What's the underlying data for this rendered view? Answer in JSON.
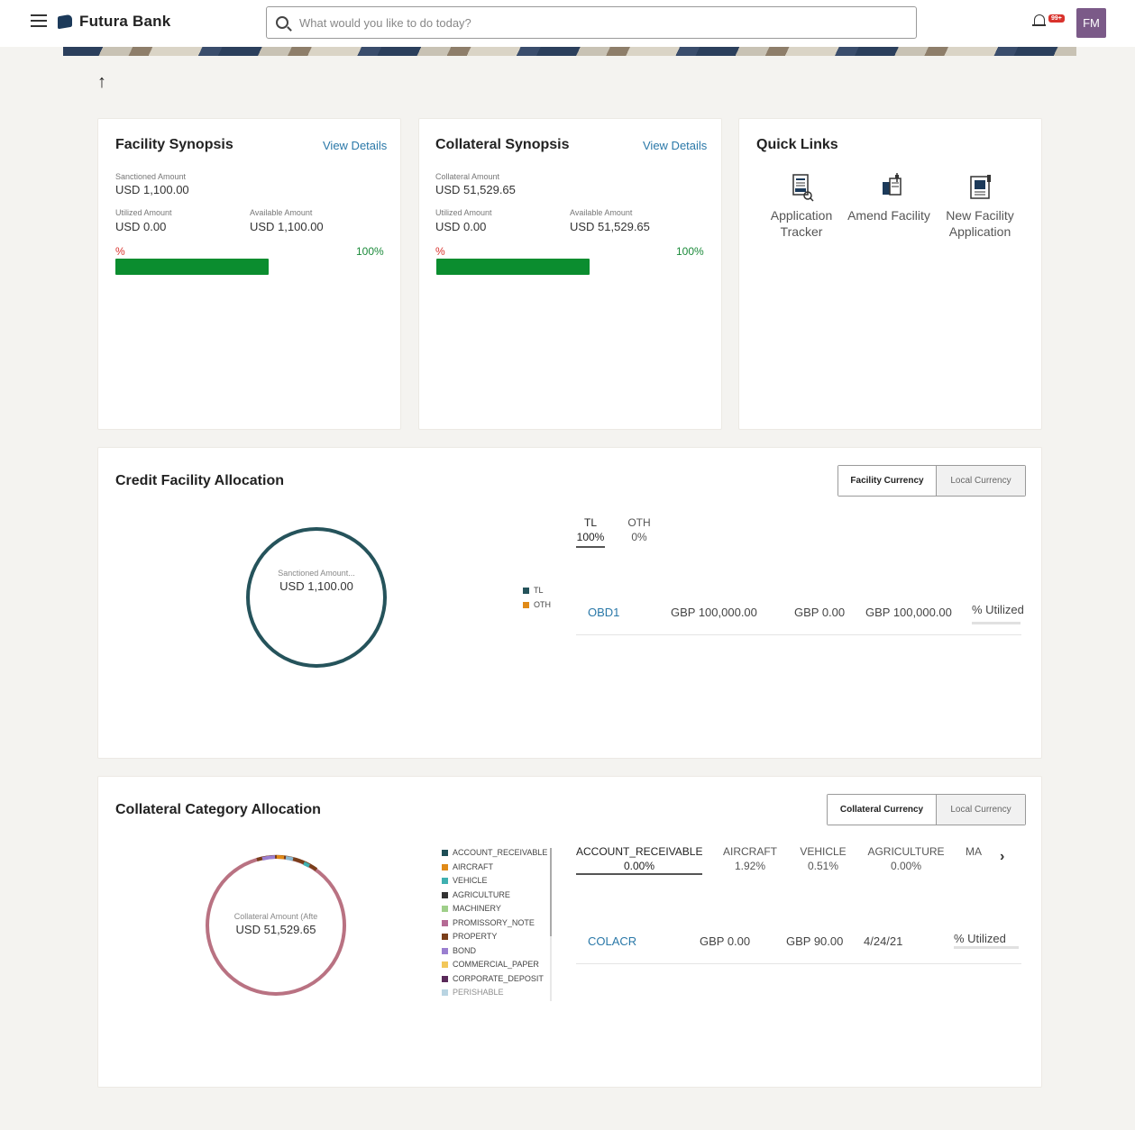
{
  "header": {
    "brand": "Futura Bank",
    "search_placeholder": "What would you like to do today?",
    "notification_badge": "99+",
    "avatar_initials": "FM"
  },
  "facility_synopsis": {
    "title": "Facility Synopsis",
    "view_details": "View Details",
    "sanctioned_label": "Sanctioned Amount",
    "sanctioned_value": "USD 1,100.00",
    "utilized_label": "Utilized Amount",
    "utilized_value": "USD 0.00",
    "available_label": "Available Amount",
    "available_value": "USD 1,100.00",
    "utilized_pct": "%",
    "available_pct": "100%"
  },
  "collateral_synopsis": {
    "title": "Collateral Synopsis",
    "view_details": "View Details",
    "collateral_label": "Collateral Amount",
    "collateral_value": "USD 51,529.65",
    "utilized_label": "Utilized Amount",
    "utilized_value": "USD 0.00",
    "available_label": "Available Amount",
    "available_value": "USD 51,529.65",
    "utilized_pct": "%",
    "available_pct": "100%"
  },
  "quick_links": {
    "title": "Quick Links",
    "items": [
      {
        "label_line1": "Application",
        "label_line2": "Tracker",
        "icon": "document-search-icon"
      },
      {
        "label_line1": "Amend Facility",
        "label_line2": "",
        "icon": "amend-document-icon"
      },
      {
        "label_line1": "New Facility",
        "label_line2": "Application",
        "icon": "new-document-icon"
      }
    ]
  },
  "credit_facility": {
    "title": "Credit Facility Allocation",
    "toggle_active": "Facility Currency",
    "toggle_inactive": "Local Currency",
    "donut_label": "Sanctioned Amount...",
    "donut_value": "USD 1,100.00",
    "legend": [
      {
        "name": "TL",
        "color": "#25535b"
      },
      {
        "name": "OTH",
        "color": "#e08a17"
      }
    ],
    "tabs": [
      {
        "name": "TL",
        "pct": "100%"
      },
      {
        "name": "OTH",
        "pct": "0%"
      }
    ],
    "row": {
      "id": "OBD1",
      "c1": "GBP 100,000.00",
      "c2": "GBP 0.00",
      "c3": "GBP 100,000.00",
      "c4": "% Utilized"
    }
  },
  "collateral_category": {
    "title": "Collateral Category Allocation",
    "toggle_active": "Collateral Currency",
    "toggle_inactive": "Local Currency",
    "donut_label": "Collateral Amount (Afte",
    "donut_value": "USD 51,529.65",
    "legend": [
      {
        "name": "ACCOUNT_RECEIVABLE",
        "color": "#1e4e56"
      },
      {
        "name": "AIRCRAFT",
        "color": "#e08a17"
      },
      {
        "name": "VEHICLE",
        "color": "#3fb0b0"
      },
      {
        "name": "AGRICULTURE",
        "color": "#333333"
      },
      {
        "name": "MACHINERY",
        "color": "#9fcf8a"
      },
      {
        "name": "PROMISSORY_NOTE",
        "color": "#b56a94"
      },
      {
        "name": "PROPERTY",
        "color": "#7a3e1a"
      },
      {
        "name": "BOND",
        "color": "#9a7fd0"
      },
      {
        "name": "COMMERCIAL_PAPER",
        "color": "#f2c75a"
      },
      {
        "name": "CORPORATE_DEPOSIT",
        "color": "#5a2a5a"
      },
      {
        "name": "PERISHABLE",
        "color": "#8bb8d0"
      }
    ],
    "tabs": [
      {
        "name": "ACCOUNT_RECEIVABLE",
        "pct": "0.00%"
      },
      {
        "name": "AIRCRAFT",
        "pct": "1.92%"
      },
      {
        "name": "VEHICLE",
        "pct": "0.51%"
      },
      {
        "name": "AGRICULTURE",
        "pct": "0.00%"
      },
      {
        "name": "MA",
        "pct": ""
      }
    ],
    "row": {
      "id": "COLACR",
      "c1": "GBP 0.00",
      "c2": "GBP 90.00",
      "c3": "4/24/21",
      "c4": "% Utilized"
    }
  }
}
